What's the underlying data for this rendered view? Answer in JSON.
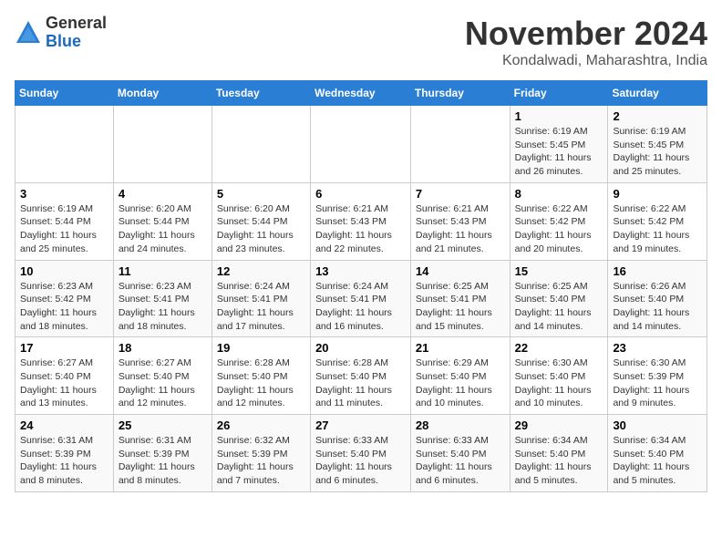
{
  "logo": {
    "general": "General",
    "blue": "Blue"
  },
  "header": {
    "title": "November 2024",
    "subtitle": "Kondalwadi, Maharashtra, India"
  },
  "weekdays": [
    "Sunday",
    "Monday",
    "Tuesday",
    "Wednesday",
    "Thursday",
    "Friday",
    "Saturday"
  ],
  "weeks": [
    [
      {
        "day": "",
        "info": ""
      },
      {
        "day": "",
        "info": ""
      },
      {
        "day": "",
        "info": ""
      },
      {
        "day": "",
        "info": ""
      },
      {
        "day": "",
        "info": ""
      },
      {
        "day": "1",
        "info": "Sunrise: 6:19 AM\nSunset: 5:45 PM\nDaylight: 11 hours and 26 minutes."
      },
      {
        "day": "2",
        "info": "Sunrise: 6:19 AM\nSunset: 5:45 PM\nDaylight: 11 hours and 25 minutes."
      }
    ],
    [
      {
        "day": "3",
        "info": "Sunrise: 6:19 AM\nSunset: 5:44 PM\nDaylight: 11 hours and 25 minutes."
      },
      {
        "day": "4",
        "info": "Sunrise: 6:20 AM\nSunset: 5:44 PM\nDaylight: 11 hours and 24 minutes."
      },
      {
        "day": "5",
        "info": "Sunrise: 6:20 AM\nSunset: 5:44 PM\nDaylight: 11 hours and 23 minutes."
      },
      {
        "day": "6",
        "info": "Sunrise: 6:21 AM\nSunset: 5:43 PM\nDaylight: 11 hours and 22 minutes."
      },
      {
        "day": "7",
        "info": "Sunrise: 6:21 AM\nSunset: 5:43 PM\nDaylight: 11 hours and 21 minutes."
      },
      {
        "day": "8",
        "info": "Sunrise: 6:22 AM\nSunset: 5:42 PM\nDaylight: 11 hours and 20 minutes."
      },
      {
        "day": "9",
        "info": "Sunrise: 6:22 AM\nSunset: 5:42 PM\nDaylight: 11 hours and 19 minutes."
      }
    ],
    [
      {
        "day": "10",
        "info": "Sunrise: 6:23 AM\nSunset: 5:42 PM\nDaylight: 11 hours and 18 minutes."
      },
      {
        "day": "11",
        "info": "Sunrise: 6:23 AM\nSunset: 5:41 PM\nDaylight: 11 hours and 18 minutes."
      },
      {
        "day": "12",
        "info": "Sunrise: 6:24 AM\nSunset: 5:41 PM\nDaylight: 11 hours and 17 minutes."
      },
      {
        "day": "13",
        "info": "Sunrise: 6:24 AM\nSunset: 5:41 PM\nDaylight: 11 hours and 16 minutes."
      },
      {
        "day": "14",
        "info": "Sunrise: 6:25 AM\nSunset: 5:41 PM\nDaylight: 11 hours and 15 minutes."
      },
      {
        "day": "15",
        "info": "Sunrise: 6:25 AM\nSunset: 5:40 PM\nDaylight: 11 hours and 14 minutes."
      },
      {
        "day": "16",
        "info": "Sunrise: 6:26 AM\nSunset: 5:40 PM\nDaylight: 11 hours and 14 minutes."
      }
    ],
    [
      {
        "day": "17",
        "info": "Sunrise: 6:27 AM\nSunset: 5:40 PM\nDaylight: 11 hours and 13 minutes."
      },
      {
        "day": "18",
        "info": "Sunrise: 6:27 AM\nSunset: 5:40 PM\nDaylight: 11 hours and 12 minutes."
      },
      {
        "day": "19",
        "info": "Sunrise: 6:28 AM\nSunset: 5:40 PM\nDaylight: 11 hours and 12 minutes."
      },
      {
        "day": "20",
        "info": "Sunrise: 6:28 AM\nSunset: 5:40 PM\nDaylight: 11 hours and 11 minutes."
      },
      {
        "day": "21",
        "info": "Sunrise: 6:29 AM\nSunset: 5:40 PM\nDaylight: 11 hours and 10 minutes."
      },
      {
        "day": "22",
        "info": "Sunrise: 6:30 AM\nSunset: 5:40 PM\nDaylight: 11 hours and 10 minutes."
      },
      {
        "day": "23",
        "info": "Sunrise: 6:30 AM\nSunset: 5:39 PM\nDaylight: 11 hours and 9 minutes."
      }
    ],
    [
      {
        "day": "24",
        "info": "Sunrise: 6:31 AM\nSunset: 5:39 PM\nDaylight: 11 hours and 8 minutes."
      },
      {
        "day": "25",
        "info": "Sunrise: 6:31 AM\nSunset: 5:39 PM\nDaylight: 11 hours and 8 minutes."
      },
      {
        "day": "26",
        "info": "Sunrise: 6:32 AM\nSunset: 5:39 PM\nDaylight: 11 hours and 7 minutes."
      },
      {
        "day": "27",
        "info": "Sunrise: 6:33 AM\nSunset: 5:40 PM\nDaylight: 11 hours and 6 minutes."
      },
      {
        "day": "28",
        "info": "Sunrise: 6:33 AM\nSunset: 5:40 PM\nDaylight: 11 hours and 6 minutes."
      },
      {
        "day": "29",
        "info": "Sunrise: 6:34 AM\nSunset: 5:40 PM\nDaylight: 11 hours and 5 minutes."
      },
      {
        "day": "30",
        "info": "Sunrise: 6:34 AM\nSunset: 5:40 PM\nDaylight: 11 hours and 5 minutes."
      }
    ]
  ]
}
